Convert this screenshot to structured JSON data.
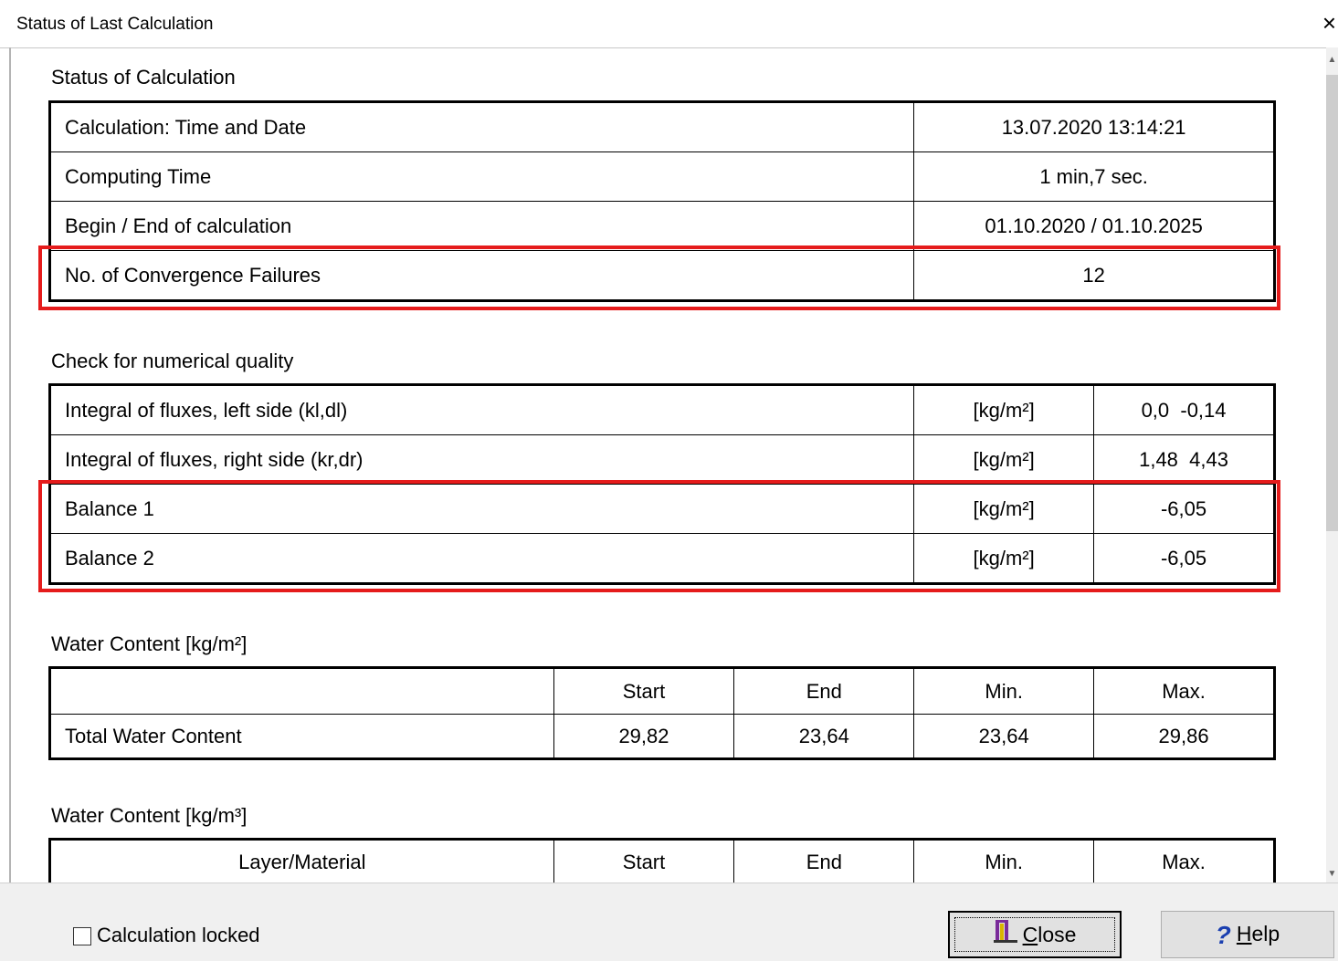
{
  "window": {
    "title": "Status of Last Calculation",
    "close_glyph": "×"
  },
  "status": {
    "heading": "Status of Calculation",
    "rows": [
      {
        "label": "Calculation: Time and Date",
        "value": "13.07.2020 13:14:21"
      },
      {
        "label": "Computing Time",
        "value": "1 min,7 sec."
      },
      {
        "label": "Begin / End of calculation",
        "value": "01.10.2020 / 01.10.2025"
      },
      {
        "label": "No. of Convergence Failures",
        "value": "12"
      }
    ]
  },
  "quality": {
    "heading": "Check for numerical quality",
    "rows": [
      {
        "label": "Integral of fluxes, left side (kl,dl)",
        "unit": "[kg/m²]",
        "value": "0,0  -0,14"
      },
      {
        "label": "Integral of fluxes, right side (kr,dr)",
        "unit": "[kg/m²]",
        "value": "1,48  4,43"
      },
      {
        "label": "Balance 1",
        "unit": "[kg/m²]",
        "value": "-6,05"
      },
      {
        "label": "Balance 2",
        "unit": "[kg/m²]",
        "value": "-6,05"
      }
    ]
  },
  "water_area": {
    "heading": "Water Content [kg/m²]",
    "headers": [
      "",
      "Start",
      "End",
      "Min.",
      "Max."
    ],
    "row": {
      "label": "Total Water Content",
      "start": "29,82",
      "end": "23,64",
      "min": "23,64",
      "max": "29,86"
    }
  },
  "water_volume": {
    "heading": "Water Content [kg/m³]",
    "headers": [
      "Layer/Material",
      "Start",
      "End",
      "Min.",
      "Max."
    ]
  },
  "footer": {
    "checkbox_label": "Calculation locked",
    "checkbox_checked": false,
    "close_label": "Close",
    "close_mnemonic": "C",
    "close_rest": "lose",
    "help_label": "Help",
    "help_mnemonic": "H",
    "help_rest": "elp",
    "help_glyph": "?"
  },
  "colors": {
    "highlight": "#e51b1b",
    "help_icon": "#1a3fb0",
    "close_icon": "#7a2b9a"
  }
}
